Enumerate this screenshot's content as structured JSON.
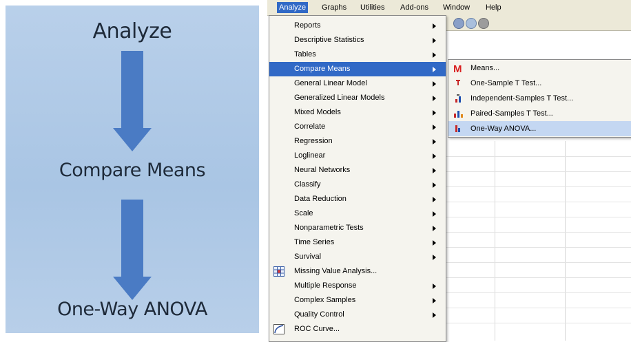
{
  "flow": {
    "step1": "Analyze",
    "step2": "Compare Means",
    "step3": "One-Way ANOVA"
  },
  "menubar": {
    "items": [
      "Analyze",
      "Graphs",
      "Utilities",
      "Add-ons",
      "Window",
      "Help"
    ],
    "active": "Analyze"
  },
  "analyze_menu": {
    "items": [
      {
        "label": "Reports",
        "submenu": true
      },
      {
        "label": "Descriptive Statistics",
        "submenu": true
      },
      {
        "label": "Tables",
        "submenu": true
      },
      {
        "label": "Compare Means",
        "submenu": true,
        "highlighted": true
      },
      {
        "label": "General Linear Model",
        "submenu": true
      },
      {
        "label": "Generalized Linear Models",
        "submenu": true
      },
      {
        "label": "Mixed Models",
        "submenu": true
      },
      {
        "label": "Correlate",
        "submenu": true
      },
      {
        "label": "Regression",
        "submenu": true
      },
      {
        "label": "Loglinear",
        "submenu": true
      },
      {
        "label": "Neural Networks",
        "submenu": true
      },
      {
        "label": "Classify",
        "submenu": true
      },
      {
        "label": "Data Reduction",
        "submenu": true
      },
      {
        "label": "Scale",
        "submenu": true
      },
      {
        "label": "Nonparametric Tests",
        "submenu": true
      },
      {
        "label": "Time Series",
        "submenu": true
      },
      {
        "label": "Survival",
        "submenu": true
      },
      {
        "label": "Missing Value Analysis...",
        "submenu": false,
        "icon": "missing-value-icon"
      },
      {
        "label": "Multiple Response",
        "submenu": true
      },
      {
        "label": "Complex Samples",
        "submenu": true
      },
      {
        "label": "Quality Control",
        "submenu": true
      },
      {
        "label": "ROC Curve...",
        "submenu": false,
        "icon": "roc-curve-icon"
      }
    ]
  },
  "compare_means_submenu": {
    "items": [
      {
        "label": "Means...",
        "icon": "means-icon"
      },
      {
        "label": "One-Sample T Test...",
        "icon": "one-sample-t-icon"
      },
      {
        "label": "Independent-Samples T Test...",
        "icon": "independent-t-icon"
      },
      {
        "label": "Paired-Samples T Test...",
        "icon": "paired-t-icon"
      },
      {
        "label": "One-Way ANOVA...",
        "icon": "anova-icon",
        "highlighted": true
      }
    ]
  },
  "colors": {
    "panel_bg": "#b9d0ea",
    "arrow_fill": "#4a7bc4",
    "menu_highlight": "#3169c6",
    "submenu_highlight": "#c4d7f2",
    "means_icon": "#d92020"
  }
}
